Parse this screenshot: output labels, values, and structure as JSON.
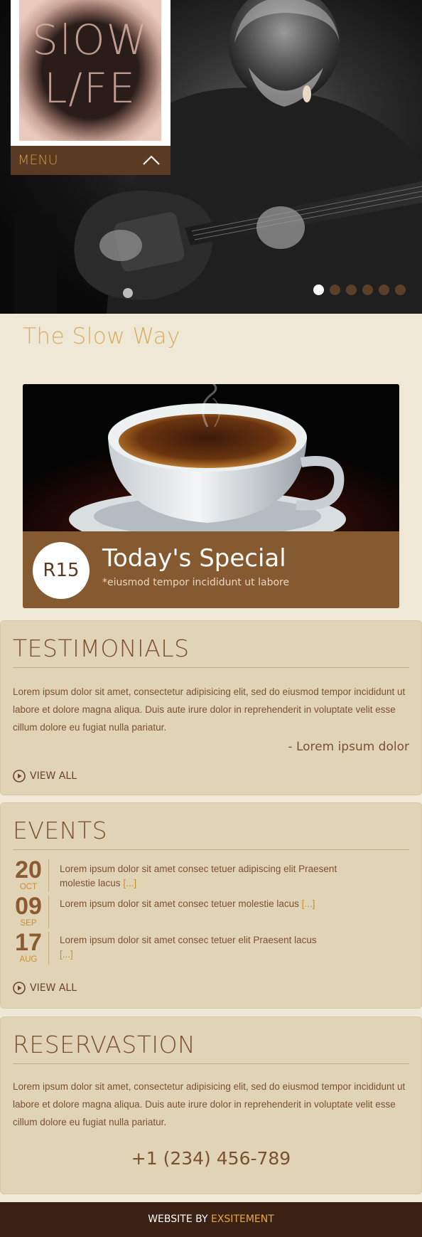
{
  "hero": {
    "logo": {
      "line1": "SlOW",
      "line2": "L/FE"
    },
    "menu_label": "MENU",
    "slider": {
      "total": 6,
      "active": 1
    }
  },
  "slow_way": {
    "title": "The Slow Way",
    "special": {
      "price": "R15",
      "title": "Today's Special",
      "subtitle": "*eiusmod tempor incididunt ut labore"
    }
  },
  "testimonials": {
    "title": "TESTIMONIALS",
    "text": "Lorem ipsum dolor sit amet, consectetur adipisicing elit, sed do eiusmod tempor incididunt ut labore et dolore magna aliqua. Duis aute irure dolor in reprehenderit in voluptate velit esse cillum dolore eu fugiat nulla pariatur.",
    "author": "- Lorem ipsum dolor",
    "view_all": "VIEW ALL"
  },
  "events": {
    "title": "EVENTS",
    "items": [
      {
        "day": "20",
        "month": "OCT",
        "text": "Lorem ipsum dolor sit amet consec tetuer adipiscing elit Praesent molestie lacus",
        "more": "[...]"
      },
      {
        "day": "09",
        "month": "SEP",
        "text": "Lorem ipsum dolor sit amet consec tetuer molestie lacus",
        "more": "[...]"
      },
      {
        "day": "17",
        "month": "AUG",
        "text": "Lorem ipsum dolor sit amet consec tetuer elit Praesent lacus",
        "more": "[...]"
      }
    ],
    "view_all": "VIEW ALL"
  },
  "reservation": {
    "title": "RESERVASTION",
    "text": "Lorem ipsum dolor sit amet, consectetur adipisicing elit, sed do eiusmod tempor incididunt ut labore et dolore magna aliqua. Duis aute irure dolor in reprehenderit in voluptate velit esse cillum dolore eu fugiat nulla pariatur.",
    "phone": "+1 (234) 456-789"
  },
  "footer": {
    "prefix": "WEBSITE BY ",
    "brand": "EXSITEMENT"
  },
  "colors": {
    "brown_dark": "#3c2214",
    "brown": "#865a31",
    "accent_gold": "#c98f2f",
    "panel_bg": "#e1d3b6",
    "page_bg": "#efe8d6"
  },
  "icons": [
    "chevron-up-icon",
    "play-circle-icon"
  ]
}
